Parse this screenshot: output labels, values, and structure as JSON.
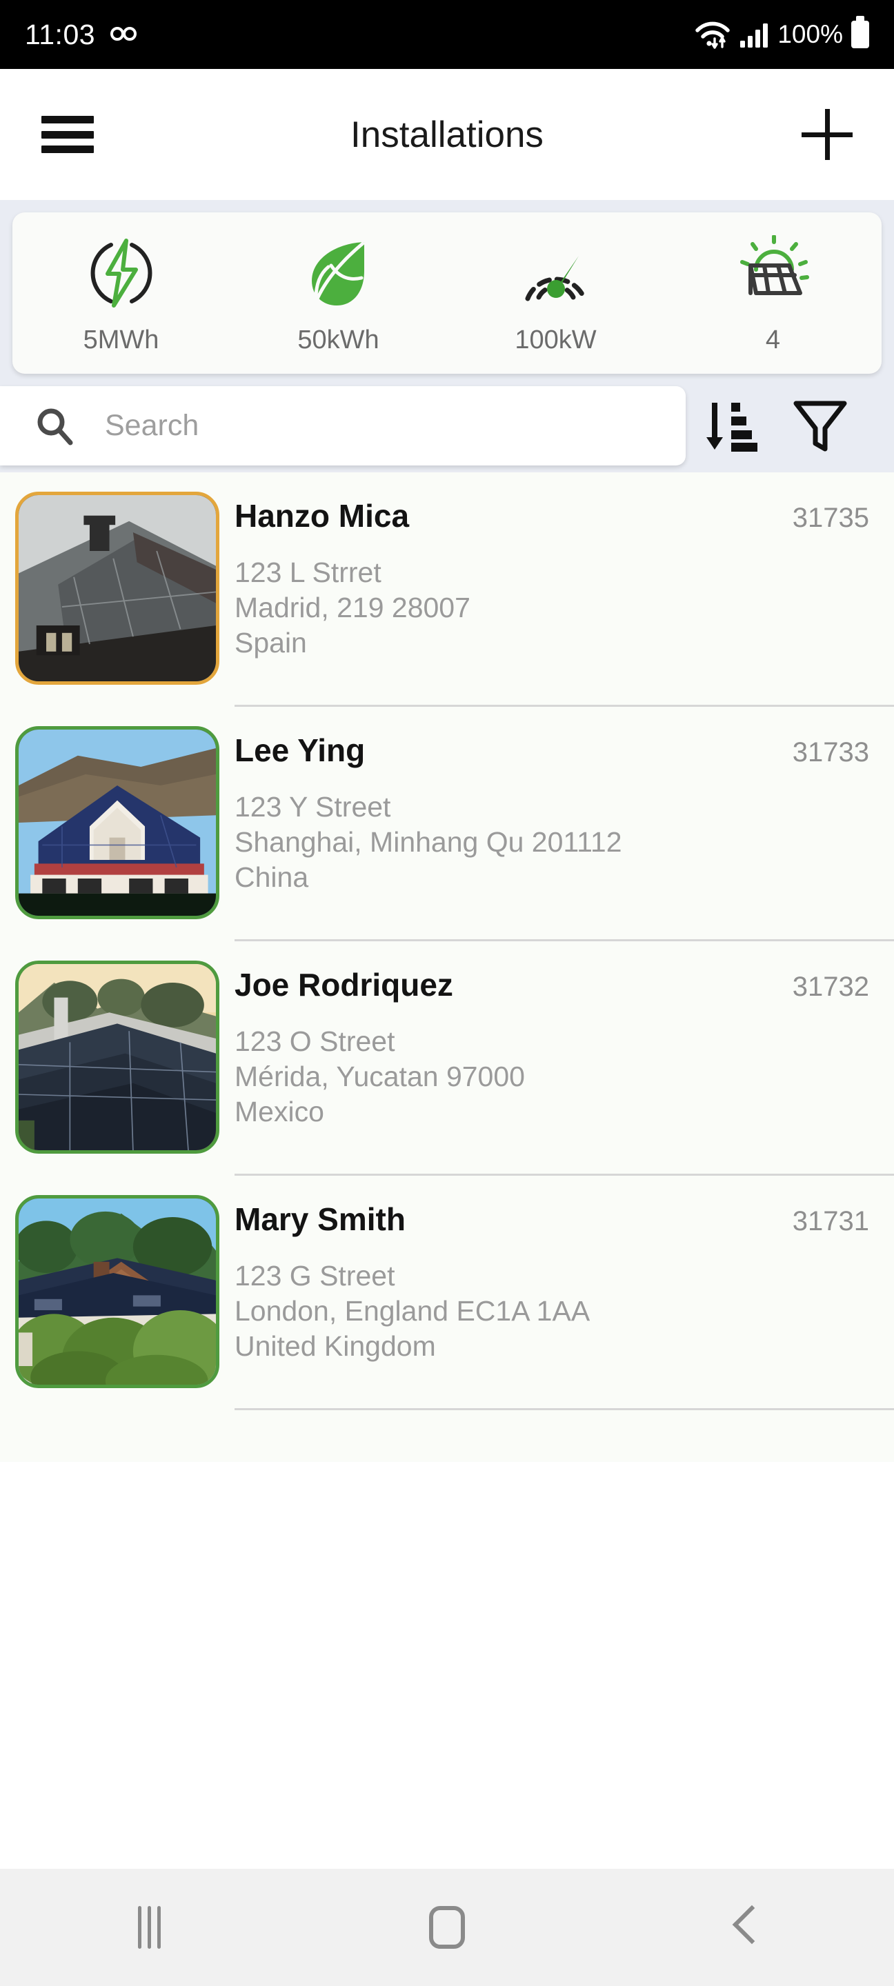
{
  "status_bar": {
    "time": "11:03",
    "voicemail_icon": "voicemail-icon",
    "wifi_icon": "wifi-icon",
    "signal_icon": "cellular-signal-icon",
    "battery_percent": "100%",
    "battery_icon": "battery-full-icon"
  },
  "app_bar": {
    "menu_icon": "hamburger-menu-icon",
    "title": "Installations",
    "add_icon": "plus-icon"
  },
  "stats": {
    "items": [
      {
        "icon": "lightning-bolt-icon",
        "value": "5MWh"
      },
      {
        "icon": "leaf-icon",
        "value": "50kWh"
      },
      {
        "icon": "gauge-icon",
        "value": "100kW"
      },
      {
        "icon": "solar-panel-sun-icon",
        "value": "4"
      }
    ]
  },
  "search": {
    "icon": "search-icon",
    "value": "",
    "placeholder": "Search",
    "sort_icon": "sort-descending-icon",
    "filter_icon": "filter-funnel-icon"
  },
  "list": {
    "items": [
      {
        "name": "Hanzo Mica",
        "id": "31735",
        "address_line1": "123 L Strret",
        "address_line2": "Madrid, 219 28007",
        "address_line3": "Spain",
        "thumbnail": "rooftop-solar-photo",
        "status_color": "#e3a63c"
      },
      {
        "name": "Lee Ying",
        "id": "31733",
        "address_line1": "123 Y Street",
        "address_line2": "Shanghai, Minhang Qu 201112",
        "address_line3": "China",
        "thumbnail": "rooftop-solar-photo",
        "status_color": "#4f9b3f"
      },
      {
        "name": "Joe Rodriquez",
        "id": "31732",
        "address_line1": "123 O Street",
        "address_line2": "Mérida, Yucatan 97000",
        "address_line3": "Mexico",
        "thumbnail": "rooftop-solar-photo",
        "status_color": "#4f9b3f"
      },
      {
        "name": "Mary Smith",
        "id": "31731",
        "address_line1": "123 G Street",
        "address_line2": "London, England EC1A 1AA",
        "address_line3": "United Kingdom",
        "thumbnail": "rooftop-solar-photo",
        "status_color": "#4f9b3f"
      }
    ]
  },
  "nav_bar": {
    "recents_icon": "recents-icon",
    "home_icon": "home-icon",
    "back_icon": "back-icon"
  },
  "colors": {
    "accent_green": "#4CAF3E",
    "warn_orange": "#e3a63c",
    "panel_bg": "#e9ecf3",
    "card_bg": "#fafbf9",
    "list_bg": "#fafcf8"
  }
}
